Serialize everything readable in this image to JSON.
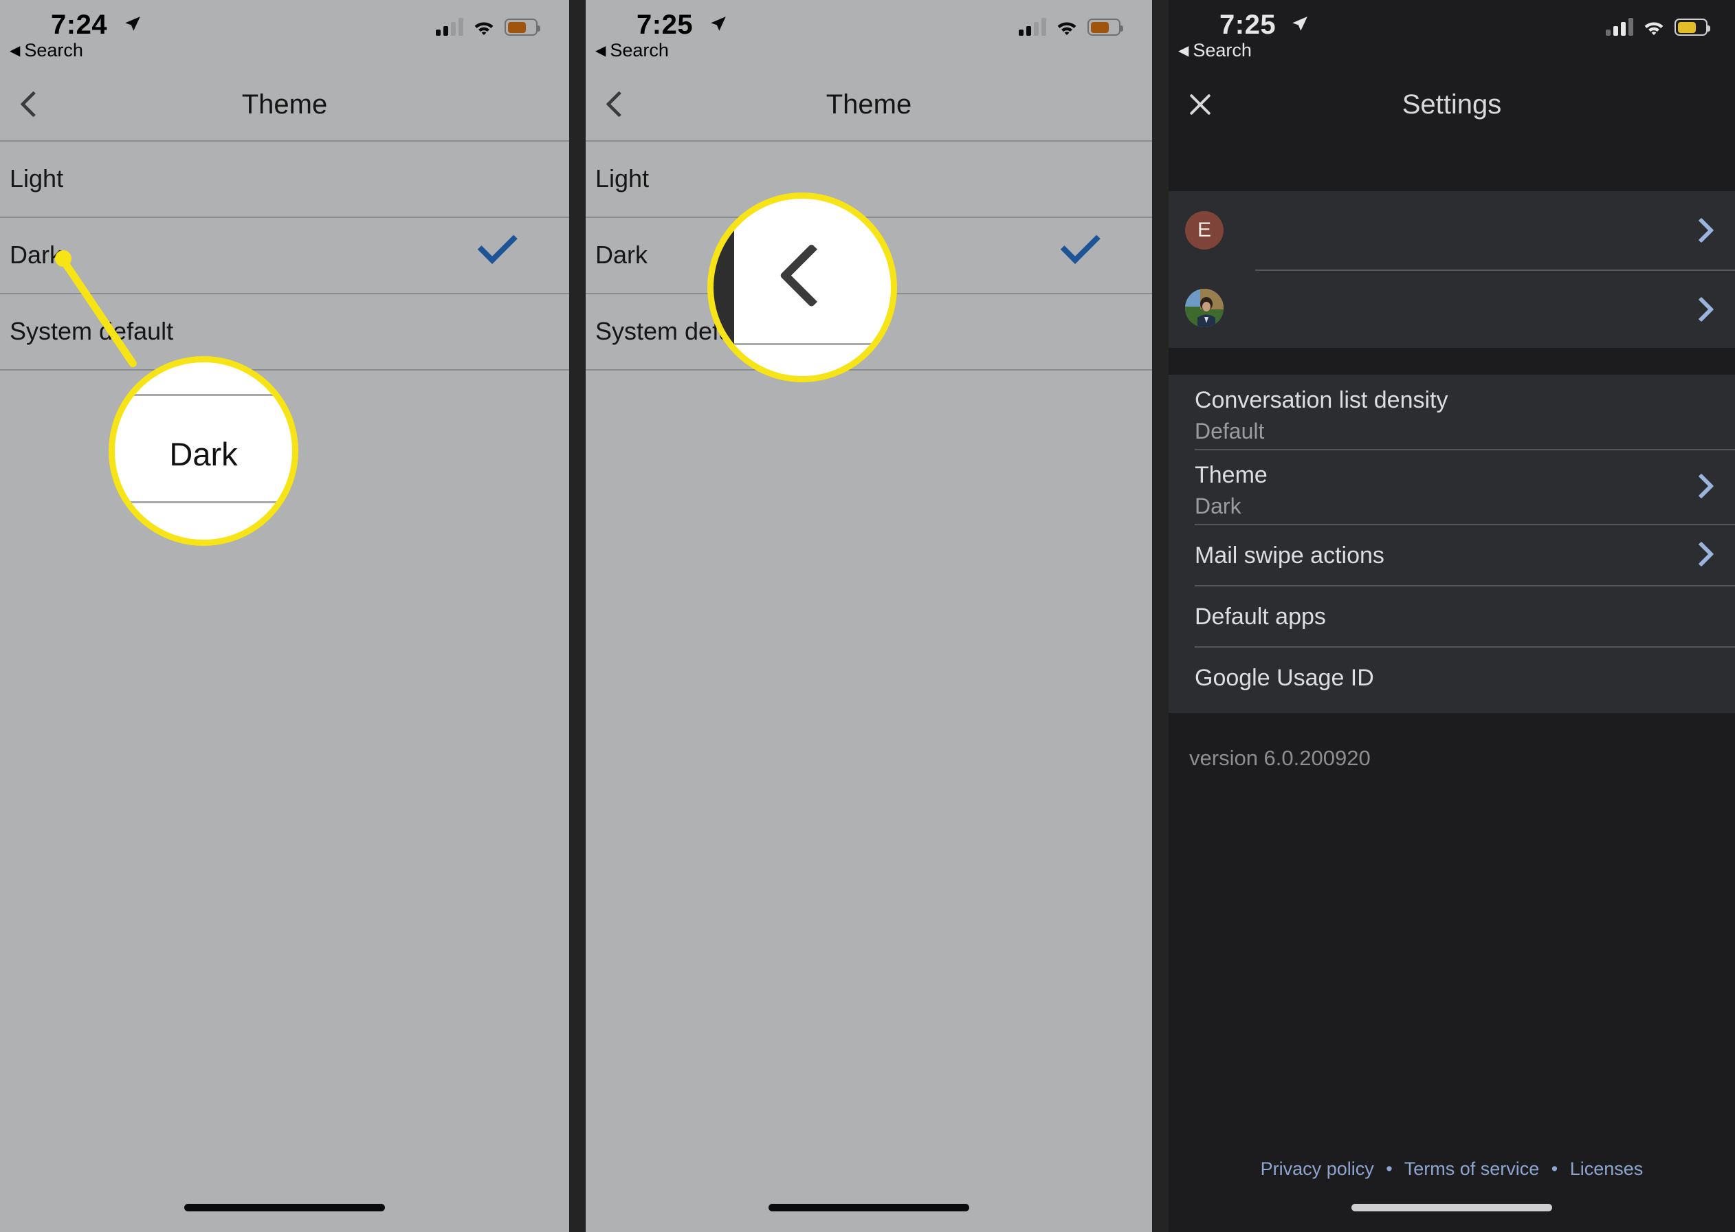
{
  "panels": [
    {
      "id": "theme-light-panel",
      "status": {
        "time": "7:24",
        "back_label": "Search",
        "location_icon": "location-arrow-icon",
        "signal_icon": "cellular-signal-icon",
        "wifi_icon": "wifi-icon",
        "battery_icon": "battery-low-power-icon"
      },
      "nav": {
        "back_icon": "chevron-left-icon",
        "title": "Theme"
      },
      "rows": [
        {
          "label": "Light",
          "checked": false
        },
        {
          "label": "Dark",
          "checked": true
        },
        {
          "label": "System default",
          "checked": false
        }
      ],
      "callout": {
        "text": "Dark",
        "kind": "text"
      }
    },
    {
      "id": "theme-back-panel",
      "status": {
        "time": "7:25",
        "back_label": "Search",
        "location_icon": "location-arrow-icon",
        "signal_icon": "cellular-signal-icon",
        "wifi_icon": "wifi-icon",
        "battery_icon": "battery-low-power-icon"
      },
      "nav": {
        "back_icon": "chevron-left-icon",
        "title": "Theme"
      },
      "rows": [
        {
          "label": "Light",
          "checked": false
        },
        {
          "label": "Dark",
          "checked": true
        },
        {
          "label": "System default",
          "checked": false
        }
      ],
      "callout": {
        "text": "",
        "kind": "chevron-left-icon"
      }
    },
    {
      "id": "settings-dark-panel",
      "status": {
        "time": "7:25",
        "back_label": "Search",
        "location_icon": "location-arrow-icon",
        "signal_icon": "cellular-signal-icon",
        "wifi_icon": "wifi-icon",
        "battery_icon": "battery-low-power-icon"
      },
      "nav": {
        "close_icon": "close-x-icon",
        "title": "Settings"
      },
      "accounts": [
        {
          "avatar_kind": "letter",
          "avatar_letter": "E",
          "label": "",
          "chevron_icon": "chevron-right-icon"
        },
        {
          "avatar_kind": "photo",
          "avatar_letter": "",
          "label": "",
          "chevron_icon": "chevron-right-icon"
        }
      ],
      "settings": [
        {
          "title": "Conversation list density",
          "value": "Default",
          "chevron": false
        },
        {
          "title": "Theme",
          "value": "Dark",
          "chevron": true
        },
        {
          "title": "Mail swipe actions",
          "value": "",
          "chevron": true
        },
        {
          "title": "Default apps",
          "value": "",
          "chevron": false
        },
        {
          "title": "Google Usage ID",
          "value": "",
          "chevron": false
        }
      ],
      "version": "version 6.0.200920",
      "footer_links": [
        "Privacy policy",
        "Terms of service",
        "Licenses"
      ],
      "footer_separator": "•"
    }
  ],
  "colors": {
    "light_bg": "#b0b1b2",
    "dark_bg": "#1c1c1e",
    "dark_card": "#2c2d30",
    "accent_check": "#1d5497",
    "callout_yellow": "#f7e416",
    "chevron_blue": "#9ab4dd",
    "link_blue": "#8ea6cf",
    "battery_light": "#a0540e",
    "battery_dark": "#e2bd27",
    "avatar_letter_bg": "#7e4339"
  }
}
